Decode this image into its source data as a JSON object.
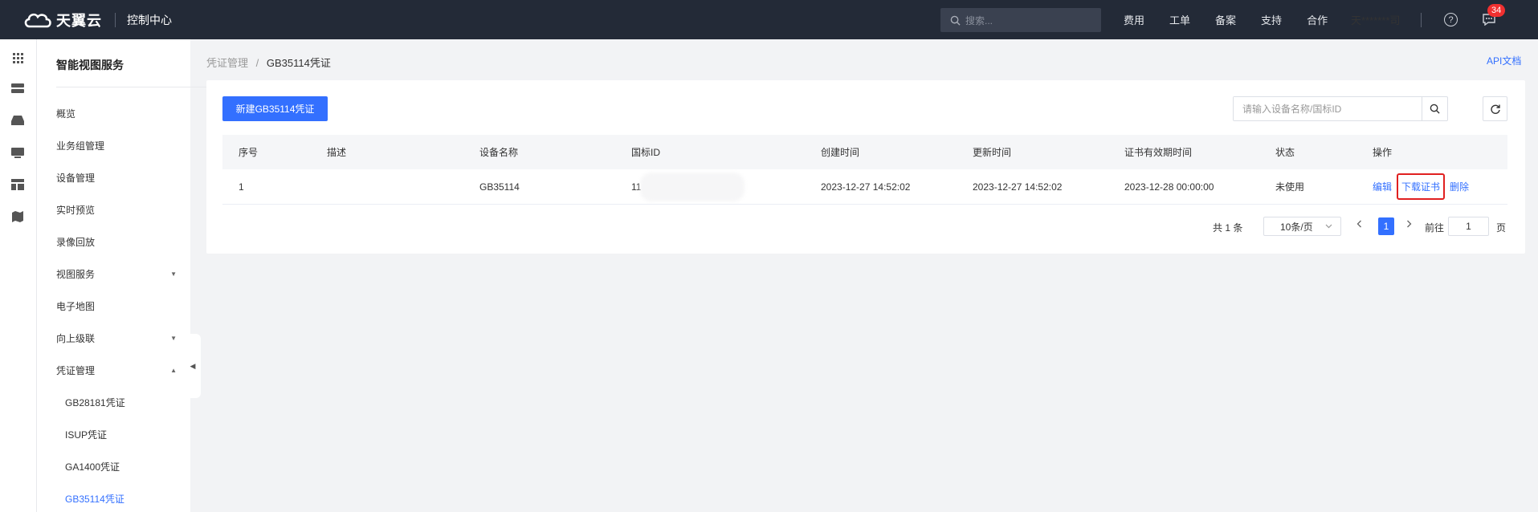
{
  "topbar": {
    "brand": "天翼云",
    "console": "控制中心",
    "search_placeholder": "搜索...",
    "nav": [
      "费用",
      "工单",
      "备案",
      "支持",
      "合作"
    ],
    "user": "天*******司",
    "help_glyph": "?",
    "badge": "34"
  },
  "sidebar": {
    "title": "智能视图服务",
    "items": [
      {
        "label": "概览"
      },
      {
        "label": "业务组管理"
      },
      {
        "label": "设备管理"
      },
      {
        "label": "实时预览"
      },
      {
        "label": "录像回放"
      },
      {
        "label": "视图服务",
        "caret": "▼"
      },
      {
        "label": "电子地图"
      },
      {
        "label": "向上级联",
        "caret": "▼"
      },
      {
        "label": "凭证管理",
        "caret": "▲"
      },
      {
        "label": "GB28181凭证"
      },
      {
        "label": "ISUP凭证"
      },
      {
        "label": "GA1400凭证"
      },
      {
        "label": "GB35114凭证"
      }
    ]
  },
  "breadcrumb": {
    "parent": "凭证管理",
    "sep": "/",
    "current": "GB35114凭证"
  },
  "api_doc": "API文档",
  "toolbar": {
    "new_label": "新建GB35114凭证",
    "search_placeholder": "请输入设备名称/国标ID"
  },
  "table": {
    "columns": [
      "序号",
      "描述",
      "设备名称",
      "国标ID",
      "创建时间",
      "更新时间",
      "证书有效期时间",
      "状态",
      "操作"
    ],
    "rows": [
      {
        "index": "1",
        "desc": "",
        "device": "GB35114",
        "gbid": "11",
        "created": "2023-12-27 14:52:02",
        "updated": "2023-12-27 14:52:02",
        "expire": "2023-12-28 00:00:00",
        "status": "未使用",
        "ops": {
          "edit": "编辑",
          "download": "下载证书",
          "delete": "删除"
        }
      }
    ]
  },
  "pager": {
    "total": "共 1 条",
    "page_size": "10条/页",
    "current": "1",
    "goto_label": "前往",
    "goto_value": "1",
    "page_unit": "页"
  },
  "colors": {
    "accent": "#3370ff",
    "topbar": "#232a37",
    "highlight": "#e02020"
  }
}
